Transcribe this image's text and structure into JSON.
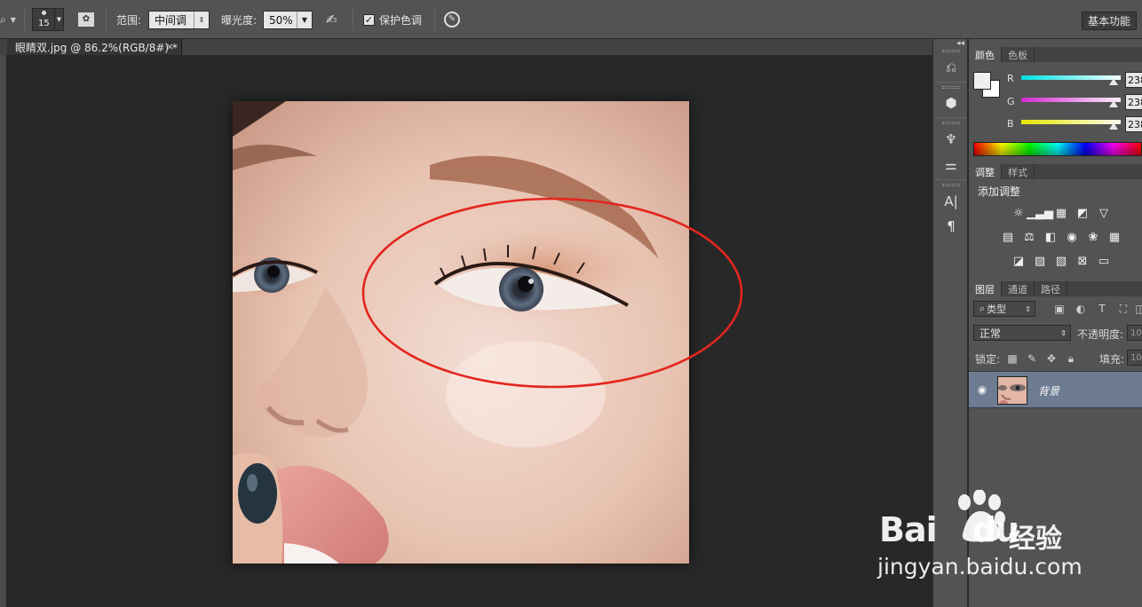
{
  "options_bar": {
    "brush_size": "15",
    "range_label": "范围:",
    "range_value": "中间调",
    "exposure_label": "曝光度:",
    "exposure_value": "50%",
    "protect_tones_label": "保护色调",
    "protect_tones_checked": true,
    "workspace_button": "基本功能"
  },
  "document_tab": {
    "title": "眼睛双.jpg @ 86.2%(RGB/8#) *",
    "close": "×"
  },
  "panel_collapse": "◂◂",
  "color_panel": {
    "tabs": [
      "颜色",
      "色板"
    ],
    "channels": [
      {
        "label": "R",
        "value": "238",
        "color": "#00d8d8"
      },
      {
        "label": "G",
        "value": "238",
        "color": "#e040e0"
      },
      {
        "label": "B",
        "value": "238",
        "color": "#e8e800"
      }
    ],
    "foreground": "#eeeeee",
    "background": "#ffffff"
  },
  "adjustments_panel": {
    "tabs": [
      "调整",
      "样式"
    ],
    "title": "添加调整",
    "icons_row1": [
      "brightness-icon",
      "levels-icon",
      "curves-icon",
      "exposure-icon",
      "gradient-triangle-icon"
    ],
    "icons_row2": [
      "vibrance-icon",
      "balance-icon",
      "black-white-icon",
      "photo-filter-icon",
      "channel-mixer-icon",
      "color-lookup-icon"
    ],
    "icons_row3": [
      "invert-icon",
      "posterize-icon",
      "threshold-icon",
      "selective-color-icon",
      "gradient-map-icon"
    ]
  },
  "layers_panel": {
    "tabs": [
      "图层",
      "通道",
      "路径"
    ],
    "filter_label": "类型",
    "blend_mode": "正常",
    "opacity_label": "不透明度:",
    "opacity_value": "10",
    "lock_label": "锁定:",
    "fill_label": "填充:",
    "fill_value": "10",
    "layers": [
      {
        "name": "背景",
        "visible": true
      }
    ]
  },
  "watermark": {
    "logo_text": "Bai",
    "logo_text2": "du",
    "cn_text": "经验",
    "url": "jingyan.baidu.com"
  },
  "annotation": {
    "shape": "ellipse",
    "color": "#e3261e"
  }
}
